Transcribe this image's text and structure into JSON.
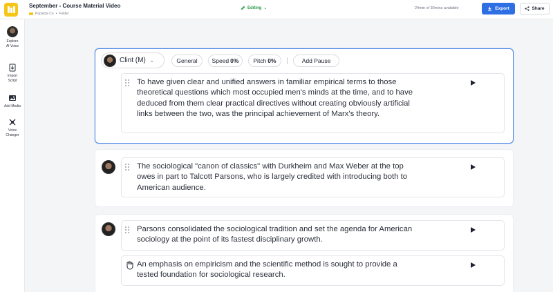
{
  "header": {
    "title": "September - Course Material Video",
    "breadcrumb": [
      "Popsicle Co",
      "Folder"
    ],
    "breadcrumb_sep": "•",
    "mode": "Editing",
    "usage": "24min of 30mins available",
    "export_label": "Export",
    "share_label": "Share"
  },
  "sidebar": {
    "items": [
      {
        "line1": "Explore",
        "line2": "AI Voice"
      },
      {
        "line1": "Import",
        "line2": "Script"
      },
      {
        "line1": "Add Media",
        "line2": ""
      },
      {
        "line1": "Voice",
        "line2": "Changer"
      }
    ]
  },
  "toolbar": {
    "voice": "Clint (M)",
    "general": "General",
    "speed_label": "Speed",
    "speed_value": "0%",
    "pitch_label": "Pitch",
    "pitch_value": "0%",
    "add_pause": "Add Pause"
  },
  "blocks": [
    {
      "text": "To have given clear and unified answers in familiar empirical terms to those theoretical questions which most occupied men's minds at the time, and to have deduced from them clear practical directives without creating obviously artificial links between the two, was the principal achievement of Marx's theory."
    },
    {
      "text": "The sociological \"canon of classics\" with Durkheim and Max Weber at the top owes in part to Talcott Parsons, who is largely credited with introducing both to American audience."
    },
    {
      "text": "Parsons consolidated the sociological tradition and set the agenda for American sociology at the point of its fastest disciplinary growth."
    },
    {
      "text": "An emphasis on empiricism and the scientific method is sought to provide a tested foundation for sociological research."
    }
  ],
  "colors": {
    "accent": "#2f6fe4",
    "selected_border": "#4a86e8",
    "editing": "#2a9d4b",
    "logo": "#f5c518"
  }
}
